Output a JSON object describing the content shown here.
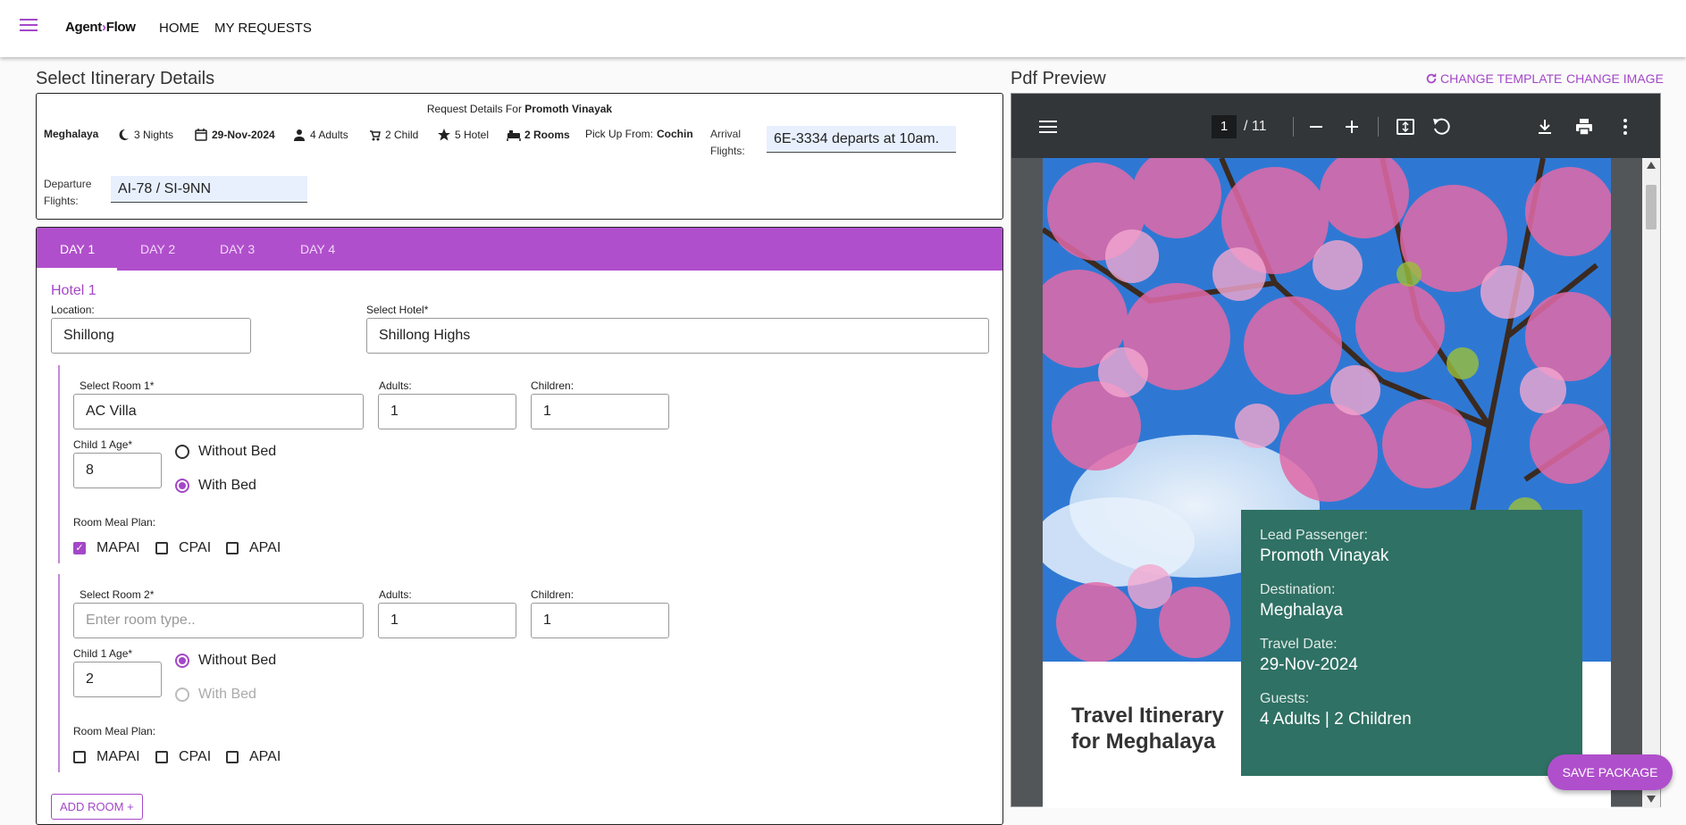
{
  "header": {
    "logo_text_a": "Agent",
    "logo_text_b": "Flow",
    "nav_home": "HOME",
    "nav_requests": "MY REQUESTS"
  },
  "left": {
    "title": "Select Itinerary Details",
    "request": {
      "title_prefix": "Request Details For ",
      "customer": "Promoth Vinayak",
      "destination": "Meghalaya",
      "nights": "3 Nights",
      "date": "29-Nov-2024",
      "adults": "4 Adults",
      "children": "2 Child",
      "hotel_rating": "5 Hotel",
      "rooms": "2 Rooms",
      "pickup_label": "Pick Up From: ",
      "pickup_value": "Cochin",
      "arrival_label_1": "Arrival",
      "arrival_label_2": "Flights:",
      "arrival_value": "6E-3334 departs at 10am.",
      "departure_label_1": "Departure",
      "departure_label_2": "Flights:",
      "departure_value": "AI-78 / SI-9NN"
    },
    "tabs": [
      "DAY 1",
      "DAY 2",
      "DAY 3",
      "DAY 4"
    ],
    "hotel_title": "Hotel 1",
    "location_label": "Location:",
    "location_value": "Shillong",
    "select_hotel_label": "Select Hotel*",
    "select_hotel_value": "Shillong Highs",
    "rooms": [
      {
        "room_label": "Select Room 1*",
        "room_value": "AC Villa",
        "adults_label": "Adults:",
        "adults_value": "1",
        "children_label": "Children:",
        "children_value": "1",
        "child_age_label": "Child 1 Age*",
        "child_age_value": "8",
        "without_bed": "Without Bed",
        "with_bed": "With Bed",
        "meal_label": "Room Meal Plan:",
        "meal_options": [
          "MAPAI",
          "CPAI",
          "APAI"
        ]
      },
      {
        "room_label": "Select Room 2*",
        "room_placeholder": "Enter room type..",
        "adults_label": "Adults:",
        "adults_value": "1",
        "children_label": "Children:",
        "children_value": "1",
        "child_age_label": "Child 1 Age*",
        "child_age_value": "2",
        "without_bed": "Without Bed",
        "with_bed": "With Bed",
        "meal_label": "Room Meal Plan:",
        "meal_options": [
          "MAPAI",
          "CPAI",
          "APAI"
        ]
      }
    ],
    "add_room": "ADD ROOM +"
  },
  "right": {
    "title": "Pdf Preview",
    "change_template": "CHANGE TEMPLATE",
    "change_image": "CHANGE IMAGE",
    "pdf": {
      "page_current": "1",
      "page_total": "/ 11",
      "lead_label": "Lead Passenger:",
      "lead_value": "Promoth Vinayak",
      "dest_label": "Destination:",
      "dest_value": "Meghalaya",
      "date_label": "Travel Date:",
      "date_value": "29-Nov-2024",
      "guests_label": "Guests:",
      "guests_value": "4 Adults | 2 Children",
      "itinerary_title_1": "Travel Itinerary",
      "itinerary_title_2": "for Meghalaya"
    }
  },
  "save_button": "SAVE PACKAGE",
  "colors": {
    "accent": "#b04fcc",
    "info_box": "#2f7164",
    "pdf_toolbar": "#323639"
  }
}
